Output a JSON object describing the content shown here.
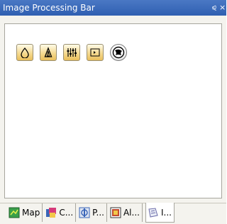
{
  "panel": {
    "title": "Image Processing Bar",
    "pin_glyph": "⪨",
    "close_glyph": "×"
  },
  "toolbar": {
    "buttons": [
      {
        "icon": "drop-icon"
      },
      {
        "icon": "triangle-icon"
      },
      {
        "icon": "sliders-icon"
      },
      {
        "icon": "stepper-icon"
      },
      {
        "icon": "globe-icon"
      }
    ]
  },
  "tabs": [
    {
      "label": "Map",
      "icon": "map-tab-icon",
      "color": "#3aa04a"
    },
    {
      "label": "C...",
      "icon": "color-tab-icon",
      "color": "#d63b7a"
    },
    {
      "label": "P...",
      "icon": "properties-tab-icon",
      "color": "#3a66b8"
    },
    {
      "label": "Al...",
      "icon": "align-tab-icon",
      "color": "#c24b2f"
    },
    {
      "label": "I...",
      "icon": "image-tab-icon",
      "color": "#6a6aa8"
    }
  ]
}
